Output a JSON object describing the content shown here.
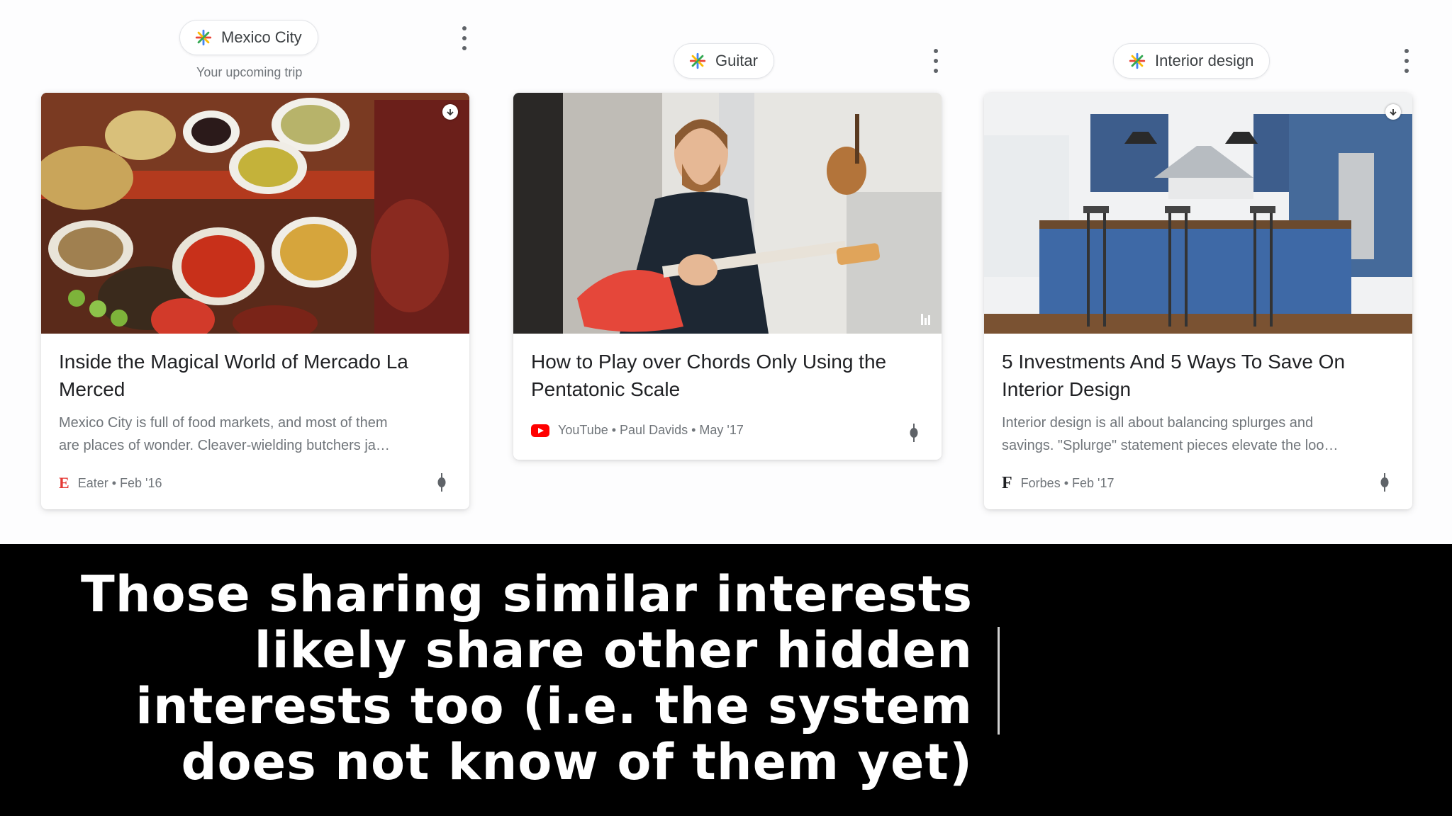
{
  "feed": {
    "columns": [
      {
        "topic": "Mexico City",
        "subtitle": "Your upcoming trip",
        "card": {
          "image": "mercado-food-market",
          "title": "Inside the Magical World of Mercado La Merced",
          "snippet_line1": "Mexico City is full of food markets, and most of them",
          "snippet_line2": "are places of wonder. Cleaver-wielding butchers ja…",
          "source": "Eater",
          "date": "Feb '16",
          "meta": "Eater • Feb '16",
          "source_logo": "E"
        }
      },
      {
        "topic": "Guitar",
        "subtitle": "",
        "card": {
          "image": "man-playing-guitar",
          "title": "How to Play over Chords Only Using the Pentatonic Scale",
          "source": "YouTube",
          "author": "Paul Davids",
          "date": "May '17",
          "meta": "YouTube • Paul Davids • May '17",
          "source_logo": "youtube-icon"
        }
      },
      {
        "topic": "Interior design",
        "subtitle": "",
        "card": {
          "image": "blue-kitchen-island",
          "title": "5 Investments And 5 Ways To Save On Interior Design",
          "snippet_line1": "Interior design is all about balancing splurges and",
          "snippet_line2": "savings. \"Splurge\" statement pieces elevate the loo…",
          "source": "Forbes",
          "date": "Feb '17",
          "meta": "Forbes • Feb '17",
          "source_logo": "F"
        }
      }
    ]
  },
  "caption": {
    "line1": "Those sharing similar interests",
    "line2": "likely share other hidden",
    "line3": "interests too (i.e. the system",
    "line4": "does not know of them yet)"
  },
  "colors": {
    "accent_red": "#e53935",
    "youtube_red": "#ff0000",
    "caption_bg": "#000000",
    "caption_text": "#ffffff"
  }
}
